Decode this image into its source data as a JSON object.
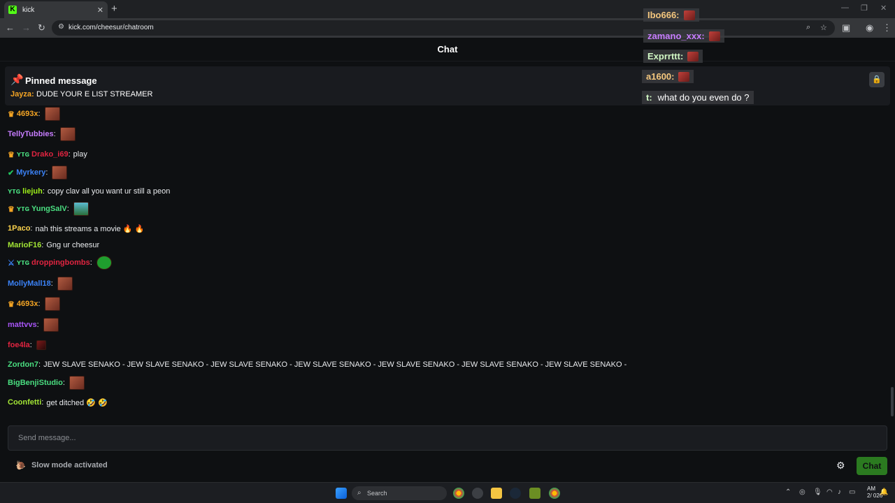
{
  "browser": {
    "tab_title": "kick",
    "tab_close": "✕",
    "new_tab": "+",
    "url": "kick.com/cheesur/chatroom",
    "favicon_letter": "K"
  },
  "chat": {
    "header_title": "Chat",
    "pinned": {
      "title": "Pinned message",
      "user": "Jayza:",
      "text": "DUDE YOUR E LIST STREAMER"
    },
    "messages": [
      {
        "badges": [
          "crown"
        ],
        "user": "4693x",
        "color": "#f5a524",
        "text": "",
        "emote": "face"
      },
      {
        "badges": [],
        "user": "TellyTubbies",
        "color": "#c77dff",
        "text": "",
        "emote": "face"
      },
      {
        "badges": [
          "crown",
          "og"
        ],
        "user": "Drako_i69",
        "color": "#e02440",
        "text": "play",
        "emote": ""
      },
      {
        "badges": [
          "verified"
        ],
        "user": "Myrkery",
        "color": "#3b82f6",
        "text": "",
        "emote": "face"
      },
      {
        "badges": [
          "og"
        ],
        "user": "liejuh",
        "color": "#9ef01a",
        "text": "copy clav all you want ur still a peon",
        "emote": ""
      },
      {
        "badges": [
          "crown",
          "og"
        ],
        "user": "YungSalV",
        "color": "#4ade80",
        "text": "",
        "emote": "figure"
      },
      {
        "badges": [],
        "user": "1Paco",
        "color": "#fcd34d",
        "text": "nah this streams a movie 🔥 🔥",
        "emote": ""
      },
      {
        "badges": [],
        "user": "MarioF16",
        "color": "#a3e635",
        "text": "Gng ur cheesur",
        "emote": ""
      },
      {
        "badges": [
          "sword",
          "og"
        ],
        "user": "droppingbombs",
        "color": "#e02440",
        "text": "",
        "emote": "green"
      },
      {
        "badges": [],
        "user": "MollyMall18",
        "color": "#3b82f6",
        "text": "",
        "emote": "face"
      },
      {
        "badges": [
          "crown"
        ],
        "user": "4693x",
        "color": "#f5a524",
        "text": "",
        "emote": "face"
      },
      {
        "badges": [],
        "user": "mattvvs",
        "color": "#a855f7",
        "text": "",
        "emote": "face"
      },
      {
        "badges": [],
        "user": "foe4la",
        "color": "#e02440",
        "text": "",
        "emote": "dark"
      },
      {
        "badges": [],
        "user": "Zordon7",
        "color": "#4ade80",
        "text": "JEW SLAVE SENAKO - JEW SLAVE SENAKO - JEW SLAVE SENAKO - JEW SLAVE SENAKO - JEW SLAVE SENAKO - JEW SLAVE SENAKO - JEW SLAVE SENAKO -",
        "emote": ""
      },
      {
        "badges": [],
        "user": "BigBenjiStudio",
        "color": "#4ade80",
        "text": "",
        "emote": "face"
      },
      {
        "badges": [],
        "user": "Coonfetti",
        "color": "#a3e635",
        "text": "get ditched 🤣 🤣",
        "emote": ""
      }
    ],
    "input_placeholder": "Send message...",
    "slow_mode": "Slow mode activated",
    "chat_button": "Chat"
  },
  "overlay": {
    "rows": [
      {
        "user": "Ibo666:",
        "color": "#f5c77e",
        "text": ""
      },
      {
        "user": "zamano_xxx:",
        "color": "#c77dff",
        "text": ""
      },
      {
        "user": "Exprrttt:",
        "color": "#d1f7c4",
        "text": ""
      },
      {
        "user": "a1600:",
        "color": "#f5c77e",
        "text": ""
      },
      {
        "user": "t:",
        "color": "#d1f7c4",
        "text": "what do you even do ?"
      }
    ]
  },
  "taskbar": {
    "search_label": "Search",
    "clock_time": "AM",
    "clock_date": "2/ 026"
  }
}
